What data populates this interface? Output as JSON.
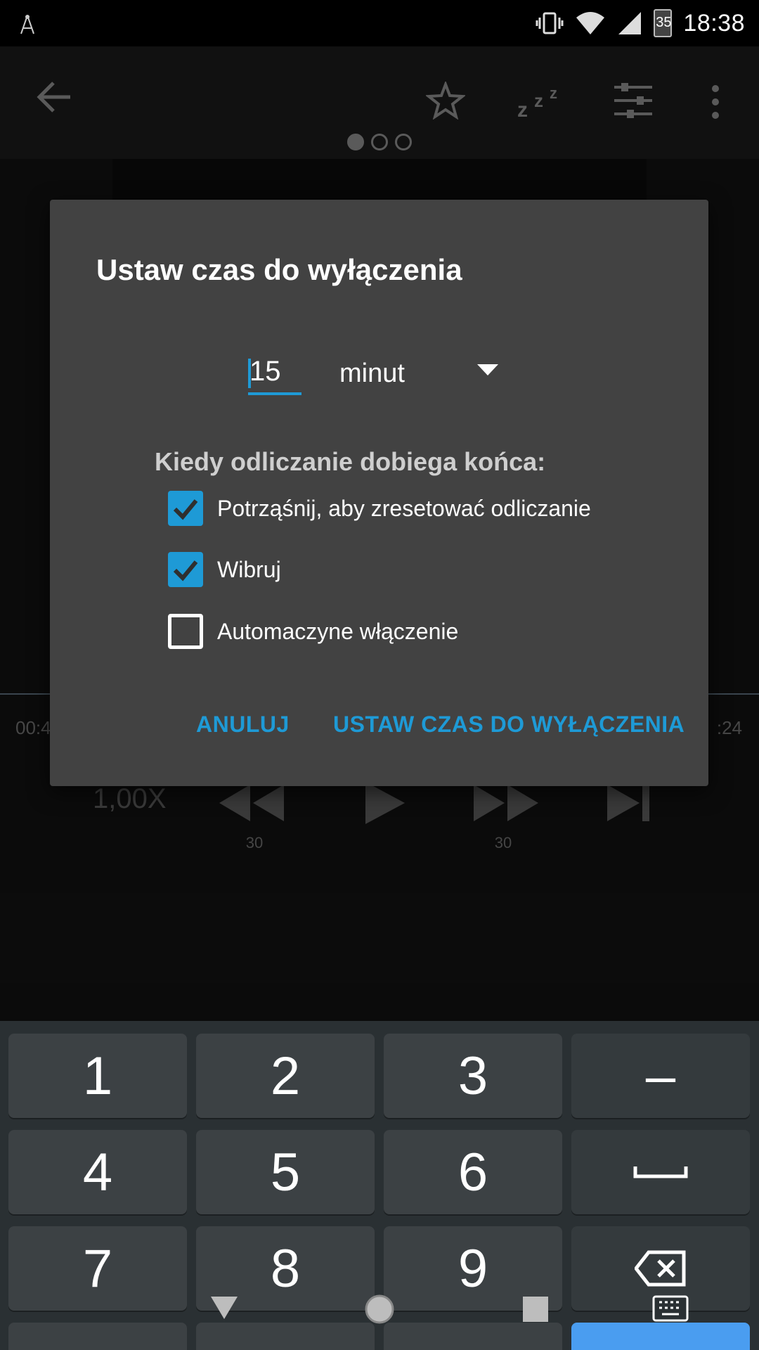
{
  "status_bar": {
    "time": "18:38",
    "battery": "35",
    "icons": [
      "signal-antenna-icon",
      "vibrate-icon",
      "wifi-icon",
      "cell-signal-icon",
      "battery-icon"
    ]
  },
  "toolbar": {
    "icons": [
      "back-arrow-icon",
      "star-icon",
      "sleep-zzz-icon",
      "equalizer-sliders-icon",
      "more-vert-icon"
    ],
    "pages": 3,
    "active_page": 1
  },
  "player": {
    "time_elapsed": "00:4",
    "time_remaining": ":24",
    "speed": "1,00X",
    "rewind_label": "30",
    "forward_label": "30"
  },
  "dialog": {
    "title": "Ustaw czas do wyłączenia",
    "number_value": "15",
    "unit_value": "minut",
    "section_label": "Kiedy odliczanie dobiega końca:",
    "options": [
      {
        "label": "Potrząśnij, aby zresetować odliczanie",
        "checked": true
      },
      {
        "label": "Wibruj",
        "checked": true
      },
      {
        "label": "Automaczyne włączenie",
        "checked": false
      }
    ],
    "cancel_label": "ANULUJ",
    "ok_label": "USTAW CZAS DO WYŁĄCZENIA",
    "accent_color": "#1e9ad6"
  },
  "keyboard": {
    "rows": [
      [
        "1",
        "2",
        "3",
        "–"
      ],
      [
        "4",
        "5",
        "6",
        "space-icon"
      ],
      [
        "7",
        "8",
        "9",
        "backspace-icon"
      ]
    ]
  }
}
